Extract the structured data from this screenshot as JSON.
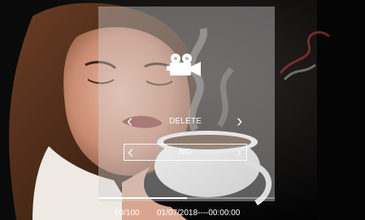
{
  "menu": {
    "mode_icon": "video-camera-icon",
    "action_label": "DELETE",
    "action_prev_icon": "chevron-left-icon",
    "action_next_icon": "chevron-right-icon",
    "option_value": "NO",
    "option_prev_icon": "chevron-left-icon",
    "option_next_icon": "chevron-right-icon"
  },
  "status": {
    "counter": "50/100",
    "timestamp": "01/07/2018----00:00:00",
    "progress_fraction": 0.5
  },
  "colors": {
    "panel_overlay": "#d2d2d2",
    "text": "#ffffff",
    "background": "#000000"
  }
}
